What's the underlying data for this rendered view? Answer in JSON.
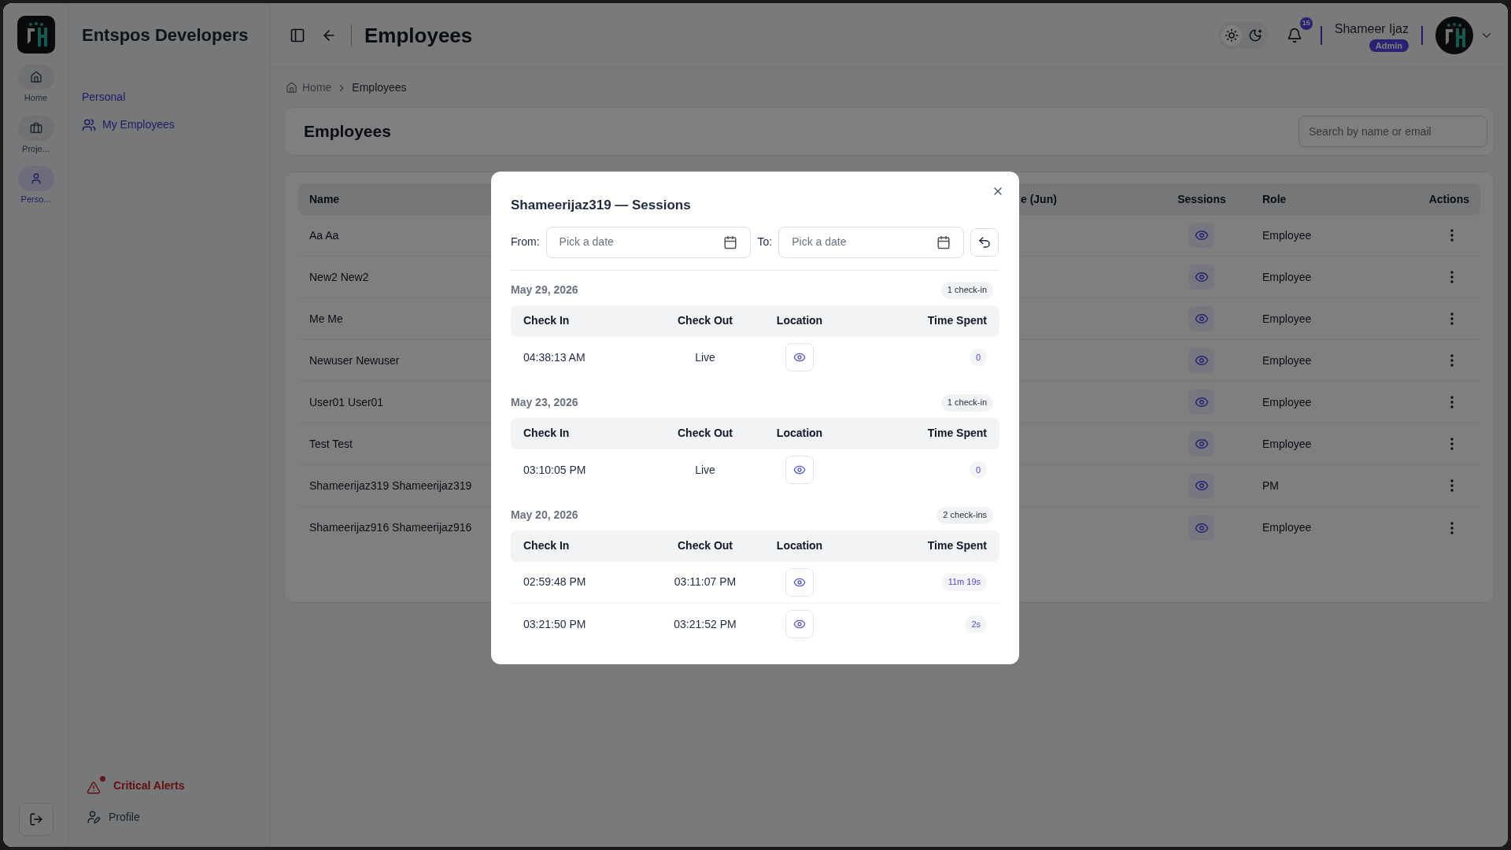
{
  "rail": {
    "items": [
      {
        "label": "Home",
        "kind": "home",
        "selected": false
      },
      {
        "label": "Proje...",
        "kind": "projects",
        "selected": false
      },
      {
        "label": "Perso...",
        "kind": "person",
        "selected": true
      }
    ]
  },
  "sidebar": {
    "title": "Entspos Developers",
    "section": "Personal",
    "items": [
      {
        "label": "My Employees",
        "selected": true
      }
    ],
    "footer_items": [
      {
        "label": "Critical Alerts",
        "kind": "alert"
      },
      {
        "label": "Profile",
        "kind": "profile"
      }
    ]
  },
  "header": {
    "title": "Employees",
    "theme_options": [
      {
        "kind": "light",
        "selected": true
      },
      {
        "kind": "dark",
        "selected": false
      }
    ],
    "notifications": "15",
    "user": {
      "name": "Shameer Ijaz",
      "role": "Admin"
    }
  },
  "breadcrumb": [
    "Home",
    "Employees"
  ],
  "page": {
    "title": "Employees",
    "search_placeholder": "Search by name or email"
  },
  "table": {
    "columns": [
      "Name",
      "e (Jun)",
      "Sessions",
      "Role",
      "Actions"
    ],
    "rows": [
      {
        "name": "Aa Aa",
        "role": "Employee"
      },
      {
        "name": "New2 New2",
        "role": "Employee"
      },
      {
        "name": "Me Me",
        "role": "Employee"
      },
      {
        "name": "Newuser Newuser",
        "role": "Employee"
      },
      {
        "name": "User01 User01",
        "role": "Employee"
      },
      {
        "name": "Test Test",
        "role": "Employee"
      },
      {
        "name": "Shameerijaz319 Shameerijaz319",
        "role": "PM"
      },
      {
        "name": "Shameerijaz916 Shameerijaz916",
        "role": "Employee"
      }
    ]
  },
  "dialog": {
    "title": "Shameerijaz319 — Sessions",
    "from_label": "From:",
    "from_placeholder": "Pick a date",
    "to_label": "To:",
    "to_placeholder": "Pick a date",
    "days": [
      {
        "date": "May 29, 2026",
        "count": "1 check-in",
        "columns": [
          "Check In",
          "Check Out",
          "Location",
          "Time Spent"
        ],
        "sessions": [
          {
            "check_in": "04:38:13 AM",
            "check_out": "Live",
            "time_spent": "0"
          }
        ]
      },
      {
        "date": "May 23, 2026",
        "count": "1 check-in",
        "columns": [
          "Check In",
          "Check Out",
          "Location",
          "Time Spent"
        ],
        "sessions": [
          {
            "check_in": "03:10:05 PM",
            "check_out": "Live",
            "time_spent": "0"
          }
        ]
      },
      {
        "date": "May 20, 2026",
        "count": "2 check-ins",
        "columns": [
          "Check In",
          "Check Out",
          "Location",
          "Time Spent"
        ],
        "sessions": [
          {
            "check_in": "02:59:48 PM",
            "check_out": "03:11:07 PM",
            "time_spent": "11m 19s"
          },
          {
            "check_in": "03:21:50 PM",
            "check_out": "03:21:52 PM",
            "time_spent": "2s"
          }
        ]
      }
    ]
  }
}
